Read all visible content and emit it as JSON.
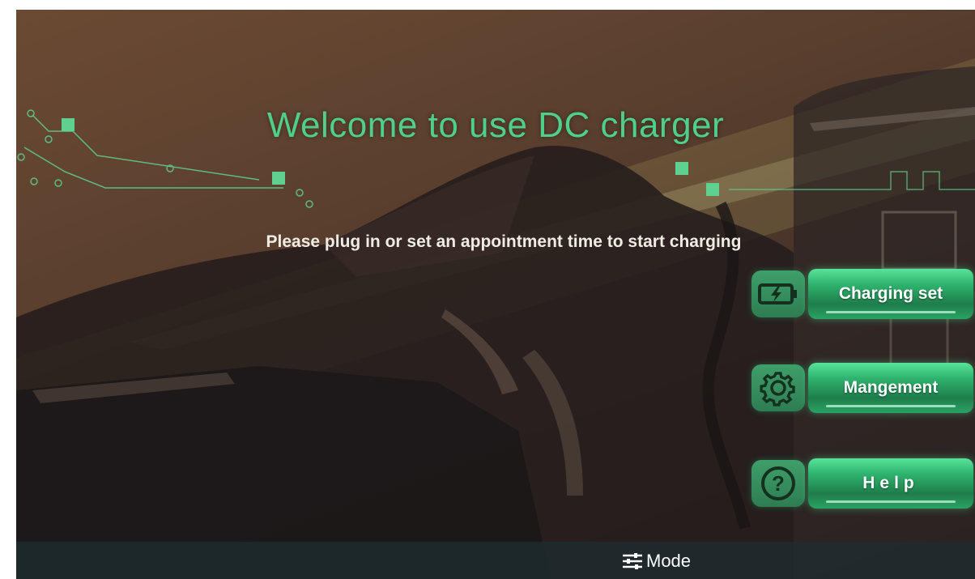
{
  "screen": {
    "title": "Welcome to use DC charger",
    "subtitle": "Please plug in or set an appointment time to start charging"
  },
  "menu": [
    {
      "label": "Charging set",
      "icon": "battery-charging-icon"
    },
    {
      "label": "Mangement",
      "icon": "gear-icon"
    },
    {
      "label": "Help",
      "icon": "help-icon"
    }
  ],
  "bottom_bar": {
    "mode_label": "Mode",
    "mode_icon": "sliders-icon"
  },
  "colors": {
    "accent_green": "#4fcf8a",
    "button_green": "#2fb56f",
    "background_brown": "#5a3f2e"
  }
}
